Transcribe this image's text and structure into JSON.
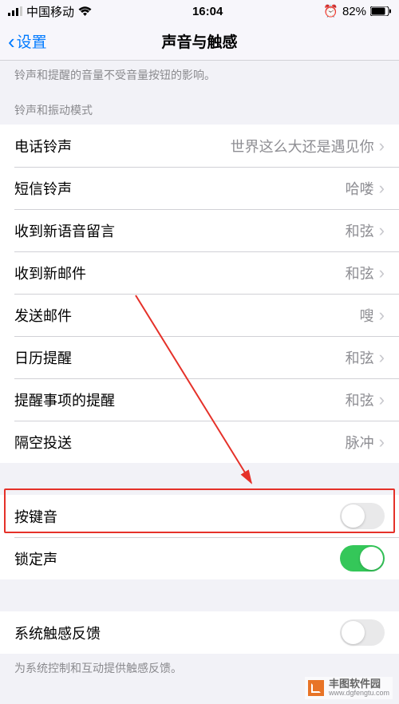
{
  "status": {
    "signal_bars": "▮▮▮▯",
    "carrier": "中国移动",
    "wifi": "�румент",
    "time": "16:04",
    "alarm": "⏰",
    "battery_pct": "82%"
  },
  "nav": {
    "back_label": "设置",
    "title": "声音与触感"
  },
  "notes": {
    "volume_hint": "铃声和提醒的音量不受音量按钮的影响。",
    "section_header": "铃声和振动模式",
    "haptics_hint": "为系统控制和互动提供触感反馈。"
  },
  "rows": {
    "ringtone": {
      "label": "电话铃声",
      "value": "世界这么大还是遇见你"
    },
    "sms": {
      "label": "短信铃声",
      "value": "哈喽"
    },
    "voicemail": {
      "label": "收到新语音留言",
      "value": "和弦"
    },
    "mail": {
      "label": "收到新邮件",
      "value": "和弦"
    },
    "sent": {
      "label": "发送邮件",
      "value": "嗖"
    },
    "calendar": {
      "label": "日历提醒",
      "value": "和弦"
    },
    "reminders": {
      "label": "提醒事项的提醒",
      "value": "和弦"
    },
    "airdrop": {
      "label": "隔空投送",
      "value": "脉冲"
    },
    "key_click": {
      "label": "按键音"
    },
    "lock_sound": {
      "label": "锁定声"
    },
    "system_haptics": {
      "label": "系统触感反馈"
    }
  },
  "watermark": {
    "main": "丰图软件园",
    "sub": "www.dgfengtu.com"
  }
}
